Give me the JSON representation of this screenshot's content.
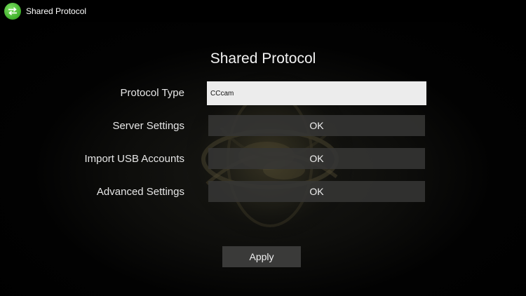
{
  "app": {
    "title": "Shared Protocol",
    "icon": "arrows-swap-icon",
    "icon_color": "#4cbb32"
  },
  "page": {
    "heading": "Shared Protocol"
  },
  "rows": {
    "protocol_type": {
      "label": "Protocol Type",
      "value": "CCcam"
    },
    "server_settings": {
      "label": "Server Settings",
      "button": "OK"
    },
    "import_usb": {
      "label": "Import USB Accounts",
      "button": "OK"
    },
    "advanced": {
      "label": "Advanced Settings",
      "button": "OK"
    }
  },
  "actions": {
    "apply_label": "Apply"
  }
}
